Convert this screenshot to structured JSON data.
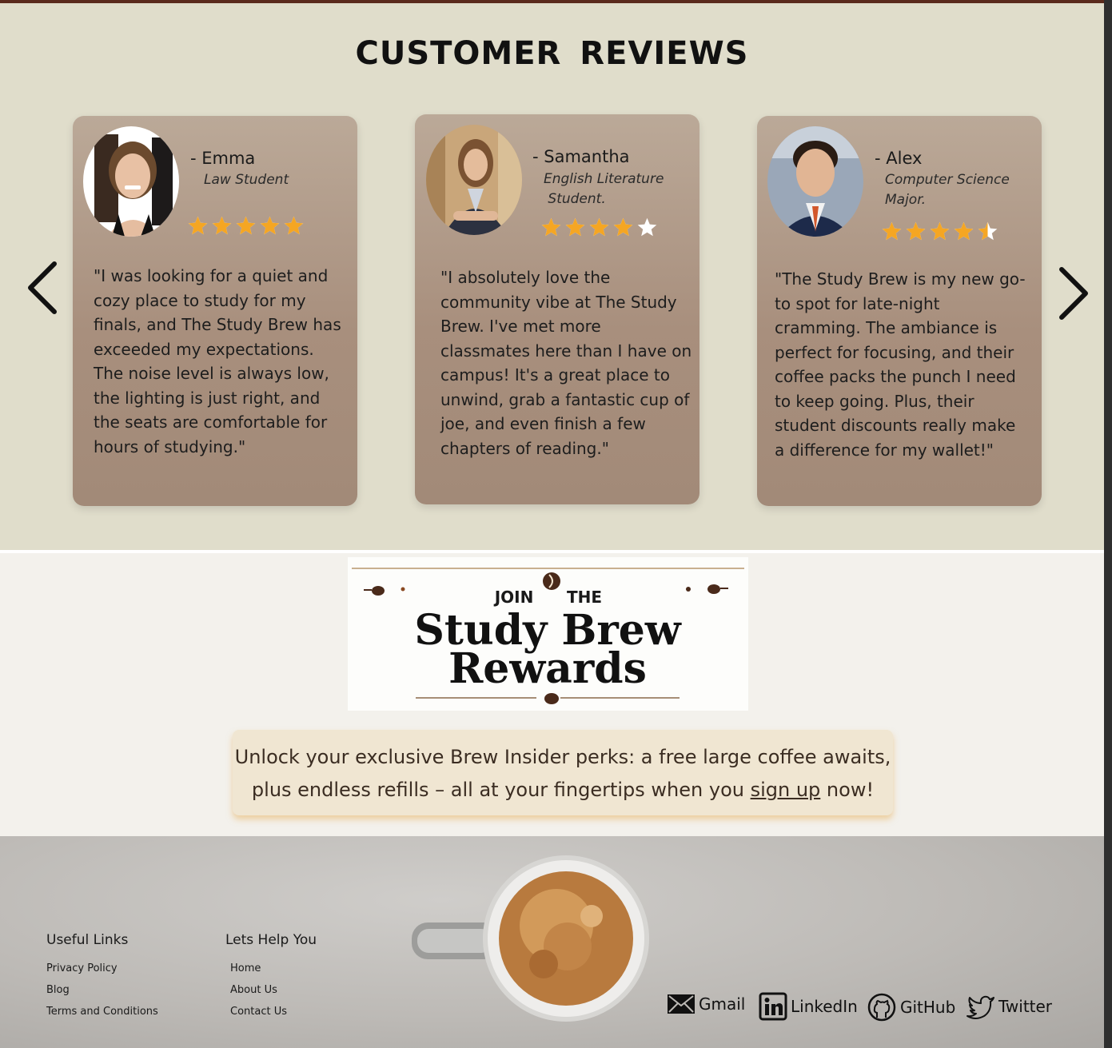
{
  "reviews": {
    "title": "CUSTOMER  REVIEWS",
    "prev_icon": "chevron-left-icon",
    "next_icon": "chevron-right-icon",
    "cards": [
      {
        "name": "- Emma",
        "role": "Law Student",
        "rating": 5,
        "quote": "\"I was looking for a quiet and cozy place to study for my finals, and The Study Brew has exceeded my expectations. The noise level is always low, the lighting is just right, and the seats are comfortable for hours of studying.\""
      },
      {
        "name": "- Samantha",
        "role": "English Literature\n Student.",
        "rating": 4,
        "quote": "\"I absolutely love the community vibe at The Study Brew. I've met more classmates here than I have on campus! It's a great place to unwind, grab a fantastic cup of joe, and even finish a few chapters of reading.\""
      },
      {
        "name": "-  Alex",
        "role": "Computer Science\nMajor.",
        "rating": 4.5,
        "quote": "\"The Study Brew is my new go-to spot for late-night cramming. The ambiance is perfect for focusing, and their coffee packs the punch I need to keep going. Plus, their student discounts really make a difference for my wallet!\""
      }
    ],
    "star_color": "#f5a623"
  },
  "rewards": {
    "logo_join": "JOIN",
    "logo_the": "THE",
    "logo_line1": "Study Brew",
    "logo_line2": "Rewards",
    "promo_before": "Unlock your exclusive Brew Insider perks: a free large coffee awaits, plus endless refills – all at your fingertips when you ",
    "promo_link": "sign up",
    "promo_after": " now!"
  },
  "footer": {
    "useful_links_title": "Useful Links",
    "useful_links": [
      "Privacy Policy",
      "Blog",
      "Terms and Conditions"
    ],
    "help_title": "Lets Help You",
    "help_links": [
      "Home",
      "About Us",
      "Contact Us"
    ],
    "social": [
      {
        "label": "Gmail",
        "icon": "mail-icon"
      },
      {
        "label": "LinkedIn",
        "icon": "linkedin-icon"
      },
      {
        "label": "GitHub",
        "icon": "github-icon"
      },
      {
        "label": "Twitter",
        "icon": "twitter-icon"
      }
    ]
  }
}
